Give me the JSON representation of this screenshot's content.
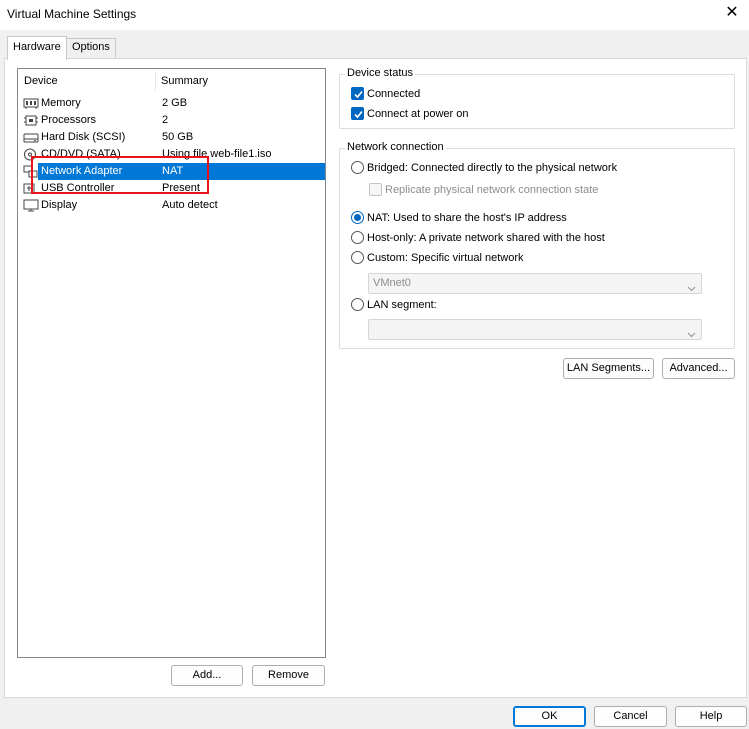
{
  "window": {
    "title": "Virtual Machine Settings"
  },
  "tabs": [
    {
      "label": "Hardware"
    },
    {
      "label": "Options"
    }
  ],
  "device_list": {
    "columns": [
      "Device",
      "Summary"
    ],
    "rows": [
      {
        "device": "Memory",
        "summary": "2 GB",
        "icon": "memory-icon"
      },
      {
        "device": "Processors",
        "summary": "2",
        "icon": "processor-icon"
      },
      {
        "device": "Hard Disk (SCSI)",
        "summary": "50 GB",
        "icon": "hard-disk-icon"
      },
      {
        "device": "CD/DVD (SATA)",
        "summary": "Using file web-file1.iso",
        "icon": "cd-dvd-icon"
      },
      {
        "device": "Network Adapter",
        "summary": "NAT",
        "icon": "network-adapter-icon",
        "selected": true
      },
      {
        "device": "USB Controller",
        "summary": "Present",
        "icon": "usb-icon"
      },
      {
        "device": "Display",
        "summary": "Auto detect",
        "icon": "display-icon"
      }
    ]
  },
  "list_buttons": {
    "add": "Add...",
    "remove": "Remove"
  },
  "device_status": {
    "title": "Device status",
    "connected": {
      "label": "Connected",
      "checked": true
    },
    "connect_at_power_on": {
      "label": "Connect at power on",
      "checked": true
    }
  },
  "network_connection": {
    "title": "Network connection",
    "bridged": {
      "label": "Bridged: Connected directly to the physical network",
      "selected": false
    },
    "replicate": {
      "label": "Replicate physical network connection state",
      "checked": false,
      "enabled": false
    },
    "nat": {
      "label": "NAT: Used to share the host's IP address",
      "selected": true
    },
    "host_only": {
      "label": "Host-only: A private network shared with the host",
      "selected": false
    },
    "custom": {
      "label": "Custom: Specific virtual network",
      "selected": false
    },
    "custom_value": "VMnet0",
    "lan_segment": {
      "label": "LAN segment:",
      "selected": false
    },
    "lan_segment_value": ""
  },
  "right_buttons": {
    "lan_segments": "LAN Segments...",
    "advanced": "Advanced..."
  },
  "footer": {
    "ok": "OK",
    "cancel": "Cancel",
    "help": "Help"
  },
  "colors": {
    "selection": "#0078d7",
    "highlight_box": "#e8141b",
    "accent": "#0067c0"
  }
}
